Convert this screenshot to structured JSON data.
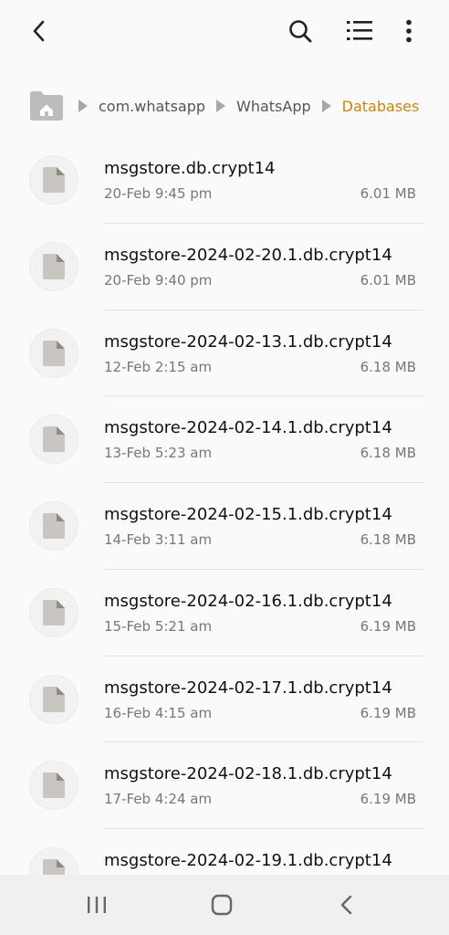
{
  "toolbar": {
    "back_icon": "chevron-left-icon",
    "search_icon": "search-icon",
    "list_view_icon": "list-view-icon",
    "more_icon": "more-vertical-icon"
  },
  "breadcrumb": {
    "home_icon": "folder-home-icon",
    "items": [
      {
        "label": "com.whatsapp"
      },
      {
        "label": "WhatsApp"
      },
      {
        "label": "Databases"
      }
    ],
    "current_color": "#c3870e"
  },
  "files": [
    {
      "name": "msgstore.db.crypt14",
      "date": "20-Feb 9:45 pm",
      "size": "6.01 MB"
    },
    {
      "name": "msgstore-2024-02-20.1.db.crypt14",
      "date": "20-Feb 9:40 pm",
      "size": "6.01 MB"
    },
    {
      "name": "msgstore-2024-02-13.1.db.crypt14",
      "date": "12-Feb 2:15 am",
      "size": "6.18 MB"
    },
    {
      "name": "msgstore-2024-02-14.1.db.crypt14",
      "date": "13-Feb 5:23 am",
      "size": "6.18 MB"
    },
    {
      "name": "msgstore-2024-02-15.1.db.crypt14",
      "date": "14-Feb 3:11 am",
      "size": "6.18 MB"
    },
    {
      "name": "msgstore-2024-02-16.1.db.crypt14",
      "date": "15-Feb 5:21 am",
      "size": "6.19 MB"
    },
    {
      "name": "msgstore-2024-02-17.1.db.crypt14",
      "date": "16-Feb 4:15 am",
      "size": "6.19 MB"
    },
    {
      "name": "msgstore-2024-02-18.1.db.crypt14",
      "date": "17-Feb 4:24 am",
      "size": "6.19 MB"
    },
    {
      "name": "msgstore-2024-02-19.1.db.crypt14",
      "date": "",
      "size": ""
    }
  ],
  "navbar": {
    "recents_icon": "recent-apps-icon",
    "home_icon": "home-circle-icon",
    "back_icon": "back-chevron-icon"
  }
}
